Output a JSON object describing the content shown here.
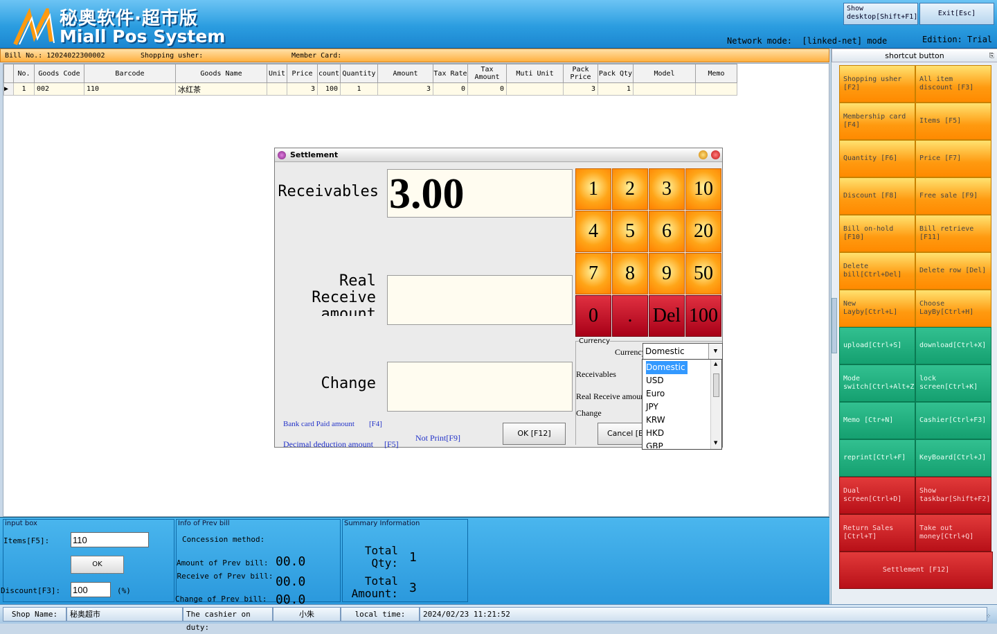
{
  "header": {
    "logo_cn": "秘奥软件·超市版",
    "logo_en": "Miall Pos System",
    "show_desktop": "Show desktop[Shift+F1]",
    "exit": "Exit[Esc]",
    "network_label": "Network mode:",
    "network_value": "[linked-net] mode",
    "edition_label": "Edition:",
    "edition_value": "Trial"
  },
  "billbar": {
    "bill_no": "Bill No.: 12024022300002",
    "shopping_usher": "Shopping usher:",
    "member_card": "Member Card:"
  },
  "grid": {
    "headers": [
      "No.",
      "Goods Code",
      "Barcode",
      "Goods Name",
      "Unit",
      "Price",
      "count",
      "Quantity",
      "Amount",
      "Tax Rate",
      "Tax Amount",
      "Muti Unit",
      "Pack Price",
      "Pack Qty",
      "Model",
      "Memo"
    ],
    "row": [
      "1",
      "002",
      "110",
      "冰红茶",
      "",
      "3",
      "100",
      "1",
      "3",
      "0",
      "0",
      "",
      "3",
      "1",
      "",
      ""
    ]
  },
  "sidebar": {
    "title": "shortcut button",
    "buttons": [
      "Shopping usher [F2]",
      "All item discount [F3]",
      "Membership card [F4]",
      "Items [F5]",
      "Quantity [F6]",
      "Price [F7]",
      "Discount [F8]",
      "Free sale [F9]",
      "Bill on-hold [F10]",
      "Bill retrieve [F11]",
      "Delete bill[Ctrl+Del]",
      "Delete row [Del]",
      "New Layby[Ctrl+L]",
      "Choose LayBy[Ctrl+H]",
      "upload[Ctrl+S]",
      "download[Ctrl+X]",
      "Mode switch[Ctrl+Alt+Z]",
      "lock screen[Ctrl+K]",
      "Memo [Ctr+N]",
      "Cashier[Ctrl+F3]",
      "reprint[Ctrl+F]",
      "KeyBoard[Ctrl+J]",
      "Dual screen[Ctrl+D]",
      "Show taskbar[Shift+F2]",
      "Return Sales [Ctrl+T]",
      "Take out money[Ctrl+Q]"
    ],
    "settlement": "Settlement [F12]"
  },
  "input_box": {
    "title": "input box",
    "items_label": "Items[F5]:",
    "items_value": "110",
    "ok": "OK",
    "discount_label": "Discount[F3]:",
    "discount_value": "100",
    "pct": "(%)"
  },
  "prev_bill": {
    "title": "Info of Prev bill",
    "concession": "Concession method:",
    "amount_label": "Amount of Prev bill:",
    "amount_value": "00.0",
    "receive_label": "Receive of Prev bill:",
    "receive_value": "00.0",
    "change_label": "Change of Prev bill:",
    "change_value": "00.0"
  },
  "summary": {
    "title": "Summary Information",
    "qty_label": "Total Qty:",
    "qty_value": "1",
    "amount_label": "Total Amount:",
    "amount_value": "3"
  },
  "status": {
    "shop_label": "Shop Name:",
    "shop_value": "秘奥超市",
    "cashier_label": "The cashier on duty:",
    "cashier_value": "小朱",
    "time_label": "local time:",
    "time_value": "2024/02/23 11:21:52"
  },
  "dialog": {
    "title": "Settlement",
    "receivables": "Receivables",
    "receivables_value": "3.00",
    "real_receive": "Real Receive amount",
    "change": "Change",
    "keys": [
      "1",
      "2",
      "3",
      "10",
      "4",
      "5",
      "6",
      "20",
      "7",
      "8",
      "9",
      "50",
      "0",
      ".",
      "Del",
      "100"
    ],
    "currency_group": "Currency",
    "currency_label": "Currency",
    "currency_value": "Domestic",
    "cur_receivables": "Receivables",
    "cur_real": "Real Receive amount",
    "cur_change": "Change",
    "bank_card": "Bank card Paid amount",
    "bank_key": "[F4]",
    "decimal": "Decimal deduction amount",
    "decimal_key": "[F5]",
    "not_print": "Not Print[F9]",
    "ok": "OK [F12]",
    "cancel": "Cancel [Esc]",
    "options": [
      "Domestic",
      "USD",
      "Euro",
      "JPY",
      "KRW",
      "HKD",
      "GBP"
    ]
  }
}
